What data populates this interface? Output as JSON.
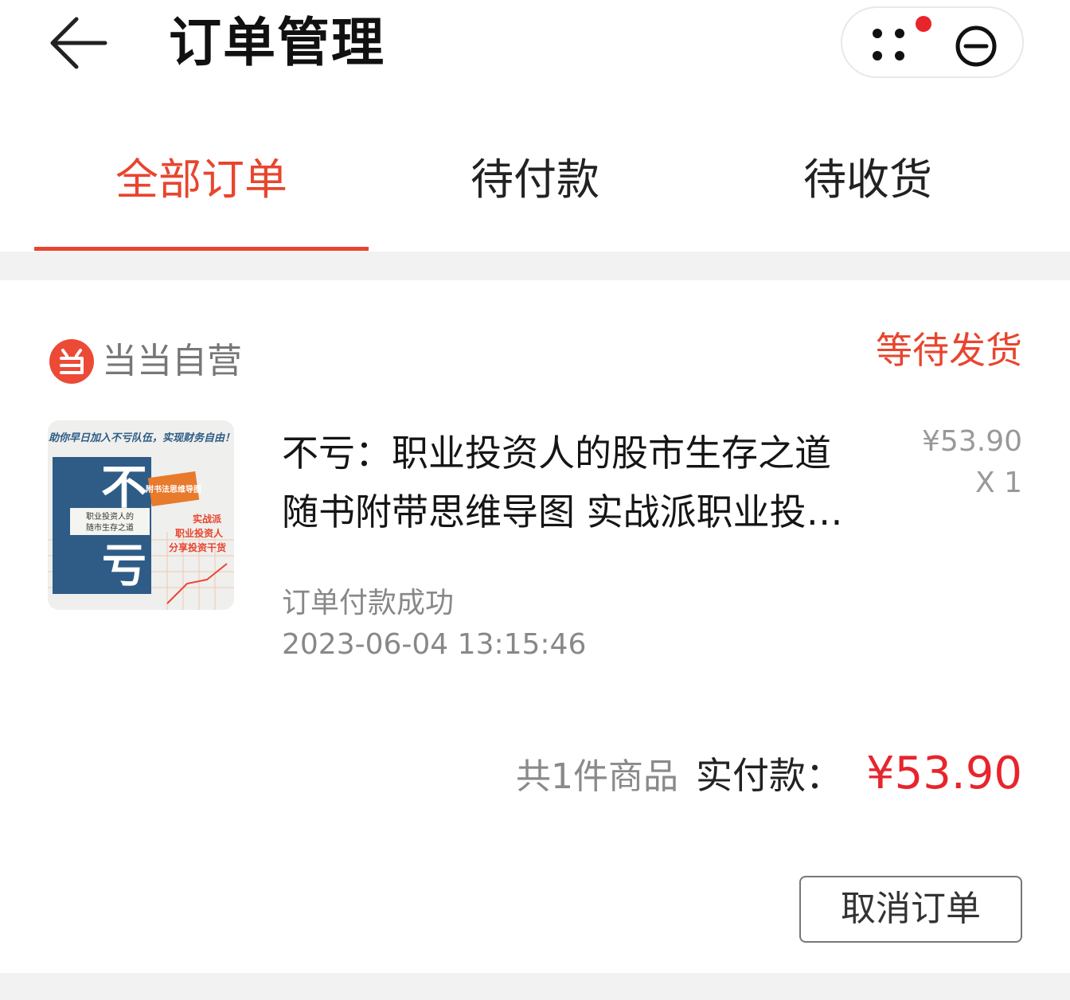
{
  "header": {
    "title": "订单管理",
    "back_icon": "arrow-left-icon",
    "more_icon": "four-dots-icon",
    "close_icon": "minus-circle-icon",
    "notification_dot_color": "#e8242c"
  },
  "tabs": [
    {
      "label": "全部订单",
      "active": true
    },
    {
      "label": "待付款",
      "active": false
    },
    {
      "label": "待收货",
      "active": false
    }
  ],
  "accent_color": "#e8452e",
  "order": {
    "shop": {
      "name": "当当自营",
      "icon": "dangdang-logo-icon"
    },
    "status": "等待发货",
    "product": {
      "title_line1": "不亏：职业投资人的股市生存之道",
      "title_line2": "随书附带思维导图 实战派职业投…",
      "price": "¥53.90",
      "quantity": "X 1",
      "cover": {
        "top_banner": "助你早日加入不亏队伍，实现财务自由！",
        "big_char_1": "不",
        "big_char_2": "亏",
        "subtitle_line1": "职业投资人的",
        "subtitle_line2": "随市生存之道",
        "tag": "附书法思维导图",
        "side_line1": "实战派",
        "side_line2": "职业投资人",
        "side_line3": "分享投资干货"
      }
    },
    "pay_status": "订单付款成功",
    "pay_time": "2023-06-04 13:15:46",
    "summary": {
      "count_text": "共1件商品",
      "paid_label": "实付款：",
      "paid_amount": "¥53.90"
    },
    "cancel_button": "取消订单"
  }
}
